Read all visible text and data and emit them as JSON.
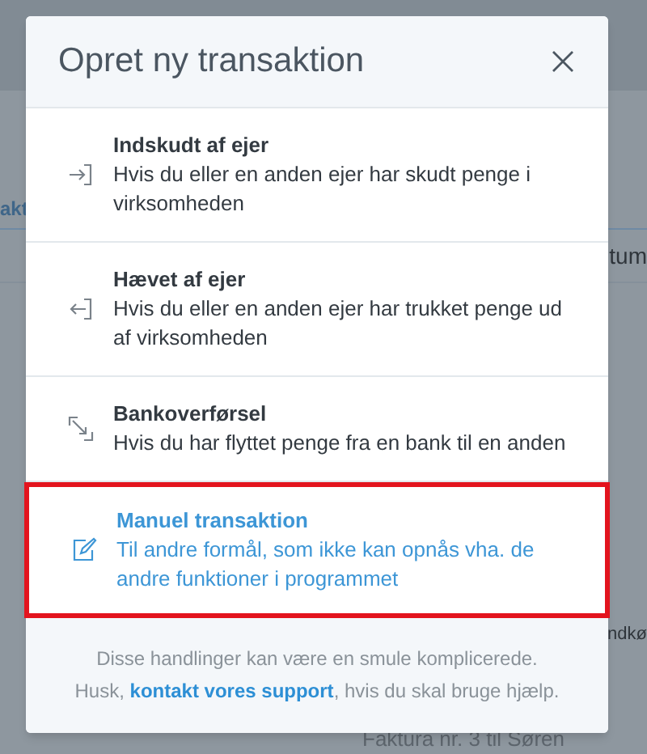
{
  "background": {
    "fragments": [
      {
        "kind": "link",
        "text": "akt"
      },
      {
        "kind": "heading",
        "text": "tum"
      },
      {
        "kind": "cell",
        "text": "ndkø"
      },
      {
        "kind": "muted",
        "text": "Faktura nr. 3 til Søren"
      }
    ]
  },
  "dialog": {
    "title": "Opret ny transaktion",
    "options": [
      {
        "kind": "deposit",
        "title": "Indskudt af ejer",
        "description": "Hvis du eller en anden ejer har skudt penge i virksomheden",
        "highlighted": false
      },
      {
        "kind": "withdrawal",
        "title": "Hævet af ejer",
        "description": "Hvis du eller en anden ejer har trukket penge ud af virksomheden",
        "highlighted": false
      },
      {
        "kind": "transfer",
        "title": "Bankoverførsel",
        "description": "Hvis du har flyttet penge fra en bank til en anden",
        "highlighted": false
      },
      {
        "kind": "manual",
        "title": "Manuel transaktion",
        "description": "Til andre formål, som ikke kan opnås vha. de andre funktioner i programmet",
        "highlighted": true
      }
    ],
    "footer": {
      "line_1": "Disse handlinger kan være en smule komplicerede.",
      "before_link": "Husk, ",
      "link": "kontakt vores support",
      "after_link": ", hvis du skal bruge hjælp."
    }
  }
}
